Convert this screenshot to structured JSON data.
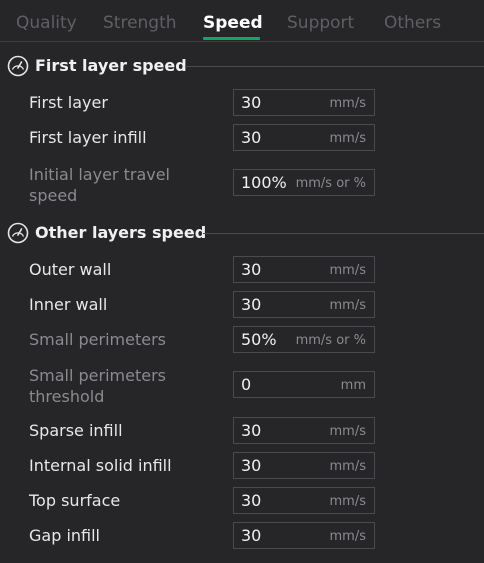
{
  "tabs": [
    {
      "label": "Quality"
    },
    {
      "label": "Strength"
    },
    {
      "label": "Speed"
    },
    {
      "label": "Support"
    },
    {
      "label": "Others"
    }
  ],
  "active_tab": "Speed",
  "sections": [
    {
      "title": "First layer speed",
      "icon": "speedometer-icon",
      "rows": [
        {
          "label": "First layer",
          "value": "30",
          "unit": "mm/s"
        },
        {
          "label": "First layer infill",
          "value": "30",
          "unit": "mm/s"
        },
        {
          "label_lines": [
            "Initial layer travel",
            "speed"
          ],
          "value": "100%",
          "unit": "mm/s or %"
        }
      ]
    },
    {
      "title": "Other layers speed",
      "icon": "speedometer-icon",
      "rows": [
        {
          "label": "Outer wall",
          "value": "30",
          "unit": "mm/s"
        },
        {
          "label": "Inner wall",
          "value": "30",
          "unit": "mm/s"
        },
        {
          "label": "Small perimeters",
          "value": "50%",
          "unit": "mm/s or %"
        },
        {
          "label_lines": [
            "Small perimeters",
            "threshold"
          ],
          "value": "0",
          "unit": "mm"
        },
        {
          "label": "Sparse infill",
          "value": "30",
          "unit": "mm/s"
        },
        {
          "label": "Internal solid infill",
          "value": "30",
          "unit": "mm/s"
        },
        {
          "label": "Top surface",
          "value": "30",
          "unit": "mm/s"
        },
        {
          "label": "Gap infill",
          "value": "30",
          "unit": "mm/s"
        }
      ]
    }
  ],
  "colors": {
    "accent": "#0fa960",
    "background": "#262629"
  }
}
